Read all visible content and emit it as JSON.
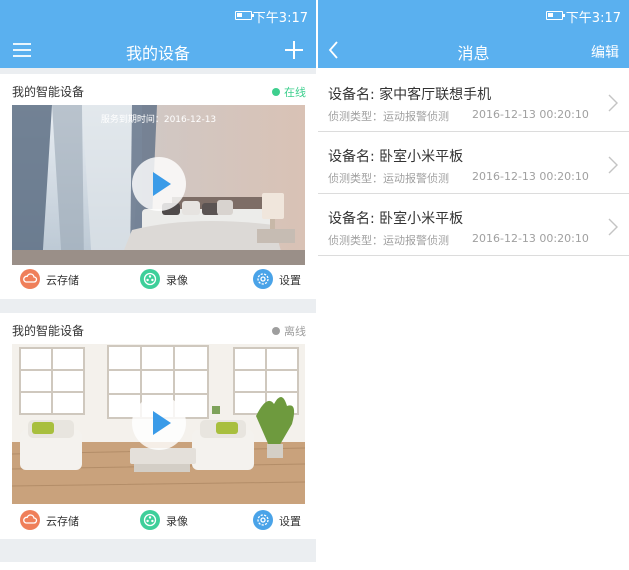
{
  "left_screen": {
    "status_time": "下午3:17",
    "title": "我的设备",
    "devices": [
      {
        "name": "我的智能设备",
        "status": "在线",
        "status_color": "#3ecf8e",
        "expiry": "服务到期时间：2016-12-13",
        "actions": [
          "云存储",
          "录像",
          "设置"
        ]
      },
      {
        "name": "我的智能设备",
        "status": "离线",
        "status_color": "#9e9e9e",
        "actions": [
          "云存储",
          "录像",
          "设置"
        ]
      }
    ]
  },
  "right_screen": {
    "status_time": "下午3:17",
    "title": "消息",
    "edit_label": "编辑",
    "messages": [
      {
        "title": "设备名: 家中客厅联想手机",
        "type": "侦测类型：运动报警侦测",
        "time": "2016-12-13 00:20:10"
      },
      {
        "title": "设备名: 卧室小米平板",
        "type": "侦测类型：运动报警侦测",
        "time": "2016-12-13 00:20:10"
      },
      {
        "title": "设备名: 卧室小米平板",
        "type": "侦测类型：运动报警侦测",
        "time": "2016-12-13 00:20:10"
      }
    ]
  },
  "colors": {
    "accent": "#5ab0ef",
    "cloud_icon": "#ef7f5a",
    "record_icon": "#3ecf9a",
    "settings_icon": "#4aa3e8",
    "play_icon": "#3a9be8"
  },
  "icons": [
    "battery-icon",
    "menu-icon",
    "add-icon",
    "back-icon",
    "play-icon",
    "cloud-storage-icon",
    "record-icon",
    "settings-icon",
    "chevron-right-icon"
  ]
}
